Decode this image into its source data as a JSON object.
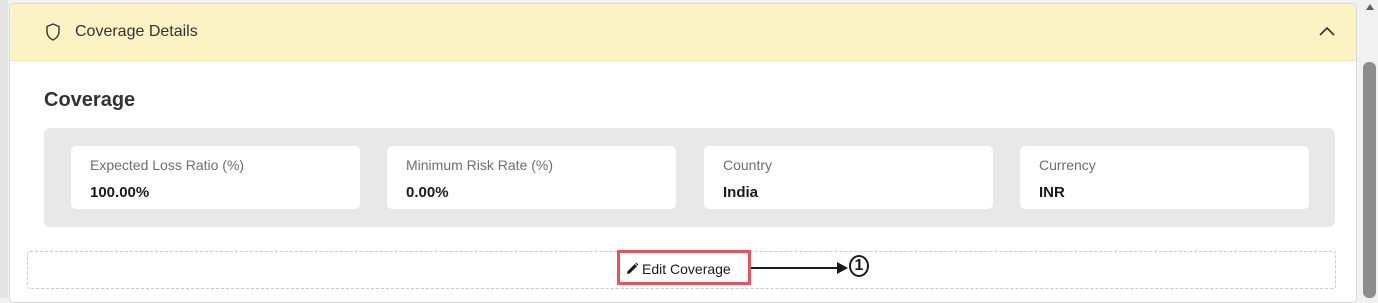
{
  "header": {
    "title": "Coverage Details",
    "icon": "shield-icon",
    "collapse_icon": "chevron-up-icon",
    "background": "#fcf3c4"
  },
  "section": {
    "title": "Coverage"
  },
  "fields": [
    {
      "label": "Expected Loss Ratio (%)",
      "value": "100.00%"
    },
    {
      "label": "Minimum Risk Rate (%)",
      "value": "0.00%"
    },
    {
      "label": "Country",
      "value": "India"
    },
    {
      "label": "Currency",
      "value": "INR"
    }
  ],
  "edit": {
    "label": "Edit Coverage",
    "icon": "pencil-icon"
  },
  "annotation": {
    "step": "1",
    "highlight_color": "#e8545d"
  }
}
